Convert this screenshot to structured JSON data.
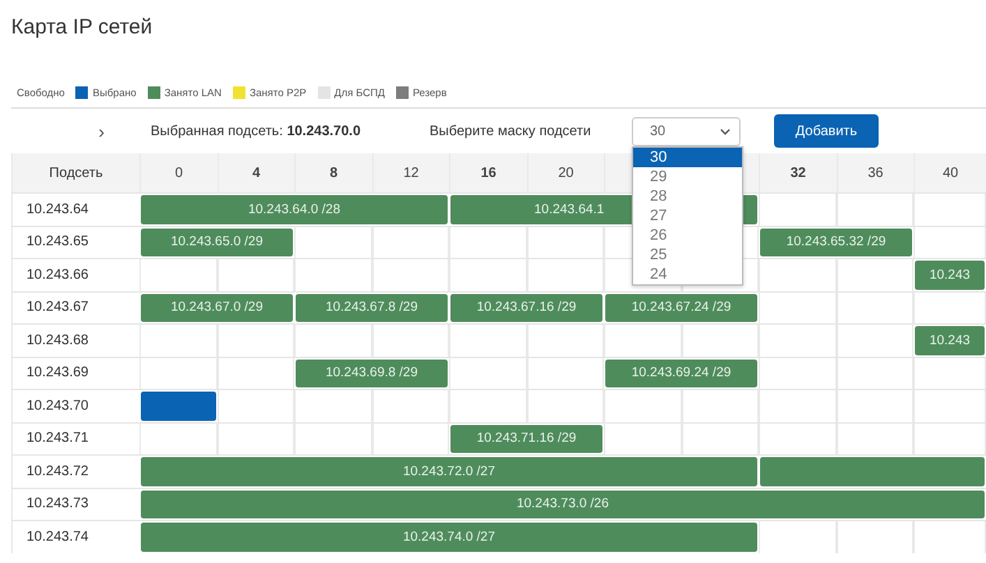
{
  "title": "Карта IP сетей",
  "legend": [
    {
      "label": "Свободно"
    },
    {
      "label": "Выбрано",
      "color": "#0b63b3"
    },
    {
      "label": "Занято LAN",
      "color": "#4f8c5c"
    },
    {
      "label": "Занято P2P",
      "color": "#f2e230"
    },
    {
      "label": "Для БСПД",
      "color": "#e4e4e4"
    },
    {
      "label": "Резерв",
      "color": "#7d7d7d"
    }
  ],
  "toolbar": {
    "expand": "›",
    "selected_label": "Выбранная подсеть:",
    "selected_subnet": "10.243.70.0",
    "mask_label": "Выберите маску подсети",
    "mask_value": "30",
    "add_button": "Добавить",
    "mask_options": [
      {
        "label": "30",
        "selected": true
      },
      {
        "label": "29",
        "selected": false
      },
      {
        "label": "28",
        "selected": false
      },
      {
        "label": "27",
        "selected": false
      },
      {
        "label": "26",
        "selected": false
      },
      {
        "label": "25",
        "selected": false
      },
      {
        "label": "24",
        "selected": false
      }
    ]
  },
  "subnet_header": "Подсеть",
  "columns": [
    {
      "label": "0",
      "bold": false
    },
    {
      "label": "4",
      "bold": true
    },
    {
      "label": "8",
      "bold": true
    },
    {
      "label": "12",
      "bold": false
    },
    {
      "label": "16",
      "bold": true
    },
    {
      "label": "20",
      "bold": false
    },
    {},
    {},
    {
      "label": "32",
      "bold": true
    },
    {
      "label": "36",
      "bold": false
    },
    {
      "label": "40",
      "bold": false
    }
  ],
  "rows": [
    {
      "subnet": "10.243.64",
      "segments": [
        {
          "kind": "lan4",
          "label": "10.243.64.0 /28"
        },
        {
          "kind": "lan4",
          "label": "10.243.64.1"
        },
        {
          "kind": "free"
        },
        {
          "kind": "free"
        },
        {
          "kind": "free"
        }
      ]
    },
    {
      "subnet": "10.243.65",
      "segments": [
        {
          "kind": "lan2",
          "label": "10.243.65.0 /29"
        },
        {
          "kind": "free"
        },
        {
          "kind": "free"
        },
        {
          "kind": "free"
        },
        {
          "kind": "free"
        },
        {
          "kind": "free"
        },
        {
          "kind": "free"
        },
        {
          "kind": "lan2",
          "label": "10.243.65.32 /29"
        },
        {
          "kind": "free"
        }
      ]
    },
    {
      "subnet": "10.243.66",
      "segments": [
        {
          "kind": "free"
        },
        {
          "kind": "free"
        },
        {
          "kind": "free"
        },
        {
          "kind": "free"
        },
        {
          "kind": "free"
        },
        {
          "kind": "free"
        },
        {
          "kind": "free"
        },
        {
          "kind": "free"
        },
        {
          "kind": "free"
        },
        {
          "kind": "free"
        },
        {
          "kind": "lanrest",
          "label": "10.243"
        }
      ]
    },
    {
      "subnet": "10.243.67",
      "segments": [
        {
          "kind": "lan2",
          "label": "10.243.67.0 /29"
        },
        {
          "kind": "lan2",
          "label": "10.243.67.8 /29"
        },
        {
          "kind": "lan2",
          "label": "10.243.67.16 /29"
        },
        {
          "kind": "lan2",
          "label": "10.243.67.24 /29"
        },
        {
          "kind": "free"
        },
        {
          "kind": "free"
        },
        {
          "kind": "free"
        }
      ]
    },
    {
      "subnet": "10.243.68",
      "segments": [
        {
          "kind": "free"
        },
        {
          "kind": "free"
        },
        {
          "kind": "free"
        },
        {
          "kind": "free"
        },
        {
          "kind": "free"
        },
        {
          "kind": "free"
        },
        {
          "kind": "free"
        },
        {
          "kind": "free"
        },
        {
          "kind": "free"
        },
        {
          "kind": "free"
        },
        {
          "kind": "lanrest",
          "label": "10.243"
        }
      ]
    },
    {
      "subnet": "10.243.69",
      "segments": [
        {
          "kind": "free"
        },
        {
          "kind": "free"
        },
        {
          "kind": "lan2",
          "label": "10.243.69.8 /29"
        },
        {
          "kind": "free"
        },
        {
          "kind": "free"
        },
        {
          "kind": "lan2",
          "label": "10.243.69.24 /29"
        },
        {
          "kind": "free"
        },
        {
          "kind": "free"
        },
        {
          "kind": "free"
        }
      ]
    },
    {
      "subnet": "10.243.70",
      "segments": [
        {
          "kind": "selected1"
        },
        {
          "kind": "free"
        },
        {
          "kind": "free"
        },
        {
          "kind": "free"
        },
        {
          "kind": "free"
        },
        {
          "kind": "free"
        },
        {
          "kind": "free"
        },
        {
          "kind": "free"
        },
        {
          "kind": "free"
        },
        {
          "kind": "free"
        },
        {
          "kind": "free"
        }
      ]
    },
    {
      "subnet": "10.243.71",
      "segments": [
        {
          "kind": "free"
        },
        {
          "kind": "free"
        },
        {
          "kind": "free"
        },
        {
          "kind": "free"
        },
        {
          "kind": "lan2",
          "label": "10.243.71.16 /29"
        },
        {
          "kind": "free"
        },
        {
          "kind": "free"
        },
        {
          "kind": "free"
        },
        {
          "kind": "free"
        },
        {
          "kind": "free"
        }
      ]
    },
    {
      "subnet": "10.243.72",
      "segments": [
        {
          "kind": "lan8",
          "label": "10.243.72.0 /27"
        },
        {
          "kind": "lanrest"
        }
      ]
    },
    {
      "subnet": "10.243.73",
      "segments": [
        {
          "kind": "lan16",
          "label": "10.243.73.0 /26"
        }
      ]
    },
    {
      "subnet": "10.243.74",
      "segments": [
        {
          "kind": "lan8",
          "label": "10.243.74.0 /27"
        },
        {
          "kind": "free"
        },
        {
          "kind": "free"
        },
        {
          "kind": "free"
        }
      ]
    }
  ]
}
